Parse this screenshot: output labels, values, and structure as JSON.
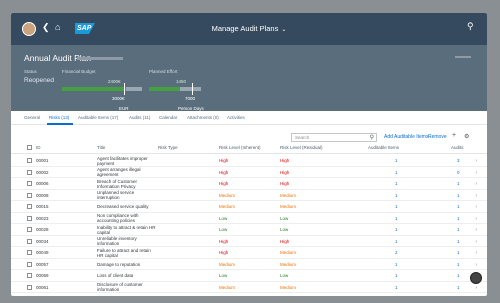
{
  "shell": {
    "title": "Manage Audit Plans",
    "logo": "SAP",
    "icons": [
      "avatar",
      "back-icon",
      "home-icon",
      "search-icon"
    ]
  },
  "header": {
    "title": "Annual Audit Plan",
    "status_label": "Status",
    "status_value": "Reopened",
    "budget_label": "Financial Budget",
    "effort_label": "Planned Effort",
    "budget_value": "2400€",
    "budget_max": "3000€",
    "budget_unit": "EUR",
    "budget_fraction": 0.8,
    "effort_value": "1450",
    "effort_max": "7000",
    "effort_unit": "Person Days",
    "effort_fraction": 0.59
  },
  "tabs": [
    {
      "label": "General",
      "active": false
    },
    {
      "label": "Risks (13)",
      "active": true
    },
    {
      "label": "Auditable Items (17)",
      "active": false
    },
    {
      "label": "Audits (11)",
      "active": false
    },
    {
      "label": "Calendar",
      "active": false
    },
    {
      "label": "Attachments (0)",
      "active": false
    },
    {
      "label": "Activities",
      "active": false
    }
  ],
  "toolbar": {
    "search_placeholder": "Search",
    "add_label": "Add Auditable Items",
    "remove_label": "Remove",
    "add_icon": "+",
    "settings_icon": "⚙"
  },
  "table": {
    "columns": [
      "ID",
      "Title",
      "Risk Type",
      "Risk Level (Inherent)",
      "Risk Level (Residual)",
      "Auditable Items",
      "Audits"
    ],
    "colors": {
      "High": "#e00000",
      "Medium": "#e9730c",
      "Low": "#2b7c2b"
    },
    "rows": [
      {
        "id": "00001",
        "title": [
          "Agent facilitates improper",
          "payment"
        ],
        "inherent": "High",
        "residual": "High",
        "items": "1",
        "audits": "3"
      },
      {
        "id": "00002",
        "title": [
          "Agent arranges illegal",
          "agreement"
        ],
        "inherent": "High",
        "residual": "High",
        "items": "1",
        "audits": "0"
      },
      {
        "id": "00006",
        "title": [
          "Breach of Customer",
          "Information Privacy"
        ],
        "inherent": "High",
        "residual": "High",
        "items": "1",
        "audits": "1"
      },
      {
        "id": "00008",
        "title": [
          "Unplanned service",
          "interruption"
        ],
        "inherent": "Medium",
        "residual": "Medium",
        "items": "1",
        "audits": "1"
      },
      {
        "id": "00015",
        "title": [
          "Decreased service quality"
        ],
        "inherent": "Medium",
        "residual": "Medium",
        "items": "1",
        "audits": "1"
      },
      {
        "id": "00023",
        "title": [
          "Non compliance with",
          "accounting policies"
        ],
        "inherent": "Low",
        "residual": "Low",
        "items": "1",
        "audits": "1"
      },
      {
        "id": "00028",
        "title": [
          "Inability to attract & retain HR",
          "capital"
        ],
        "inherent": "Low",
        "residual": "Low",
        "items": "1",
        "audits": "1"
      },
      {
        "id": "00034",
        "title": [
          "Unreliable inventory",
          "information"
        ],
        "inherent": "High",
        "residual": "High",
        "items": "1",
        "audits": "1"
      },
      {
        "id": "00049",
        "title": [
          "Failure to attract and retain",
          "HR capital"
        ],
        "inherent": "High",
        "residual": "Medium",
        "items": "2",
        "audits": "1"
      },
      {
        "id": "00057",
        "title": [
          "Damage to reputation"
        ],
        "inherent": "Medium",
        "residual": "Medium",
        "items": "1",
        "audits": "1"
      },
      {
        "id": "00059",
        "title": [
          "Loss of client data"
        ],
        "inherent": "Low",
        "residual": "Low",
        "items": "1",
        "audits": "1"
      },
      {
        "id": "00061",
        "title": [
          "Disclosure of customer",
          "information"
        ],
        "inherent": "Medium",
        "residual": "Medium",
        "items": "1",
        "audits": "1"
      }
    ]
  }
}
